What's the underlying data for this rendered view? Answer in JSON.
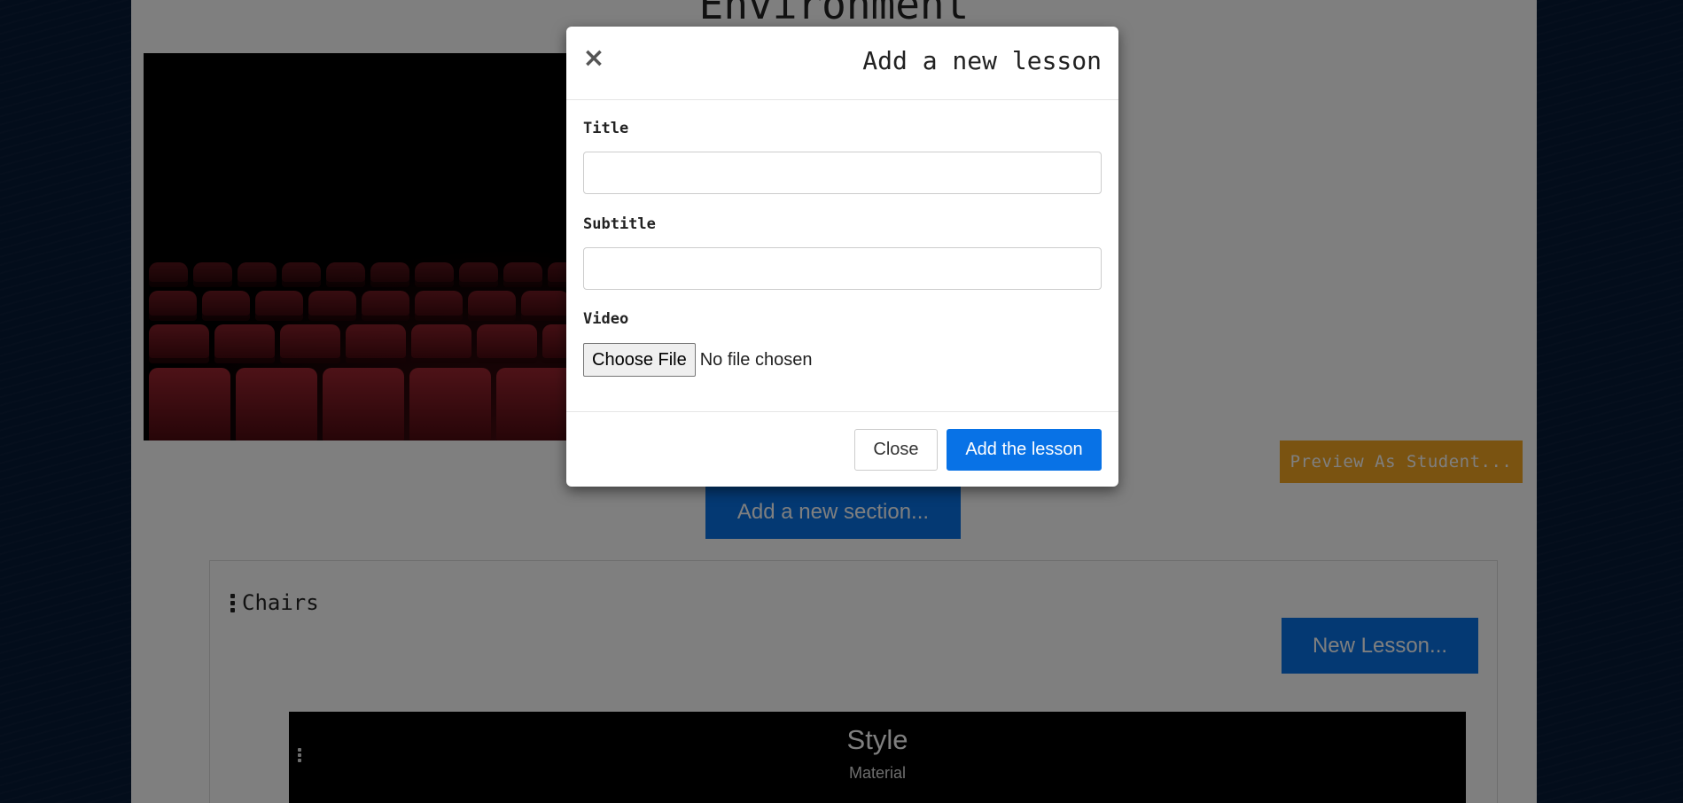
{
  "page": {
    "course_title": "Environment",
    "hero_image": "theater-seats-photo",
    "preview_button": "Preview As Student...",
    "add_section_button": "Add a new section..."
  },
  "section": {
    "name": "Chairs",
    "new_lesson_button": "New Lesson...",
    "lesson": {
      "title": "Style",
      "subtitle": "Material"
    }
  },
  "modal": {
    "title": "Add a new lesson",
    "close_icon": "×",
    "fields": {
      "title_label": "Title",
      "title_value": "",
      "subtitle_label": "Subtitle",
      "subtitle_value": "",
      "video_label": "Video",
      "file_button": "Choose File",
      "file_status": "No file chosen"
    },
    "footer": {
      "close_button": "Close",
      "add_button": "Add the lesson"
    }
  },
  "colors": {
    "primary": "#0872e6",
    "warning": "#f5a623",
    "background": "#071a36"
  }
}
